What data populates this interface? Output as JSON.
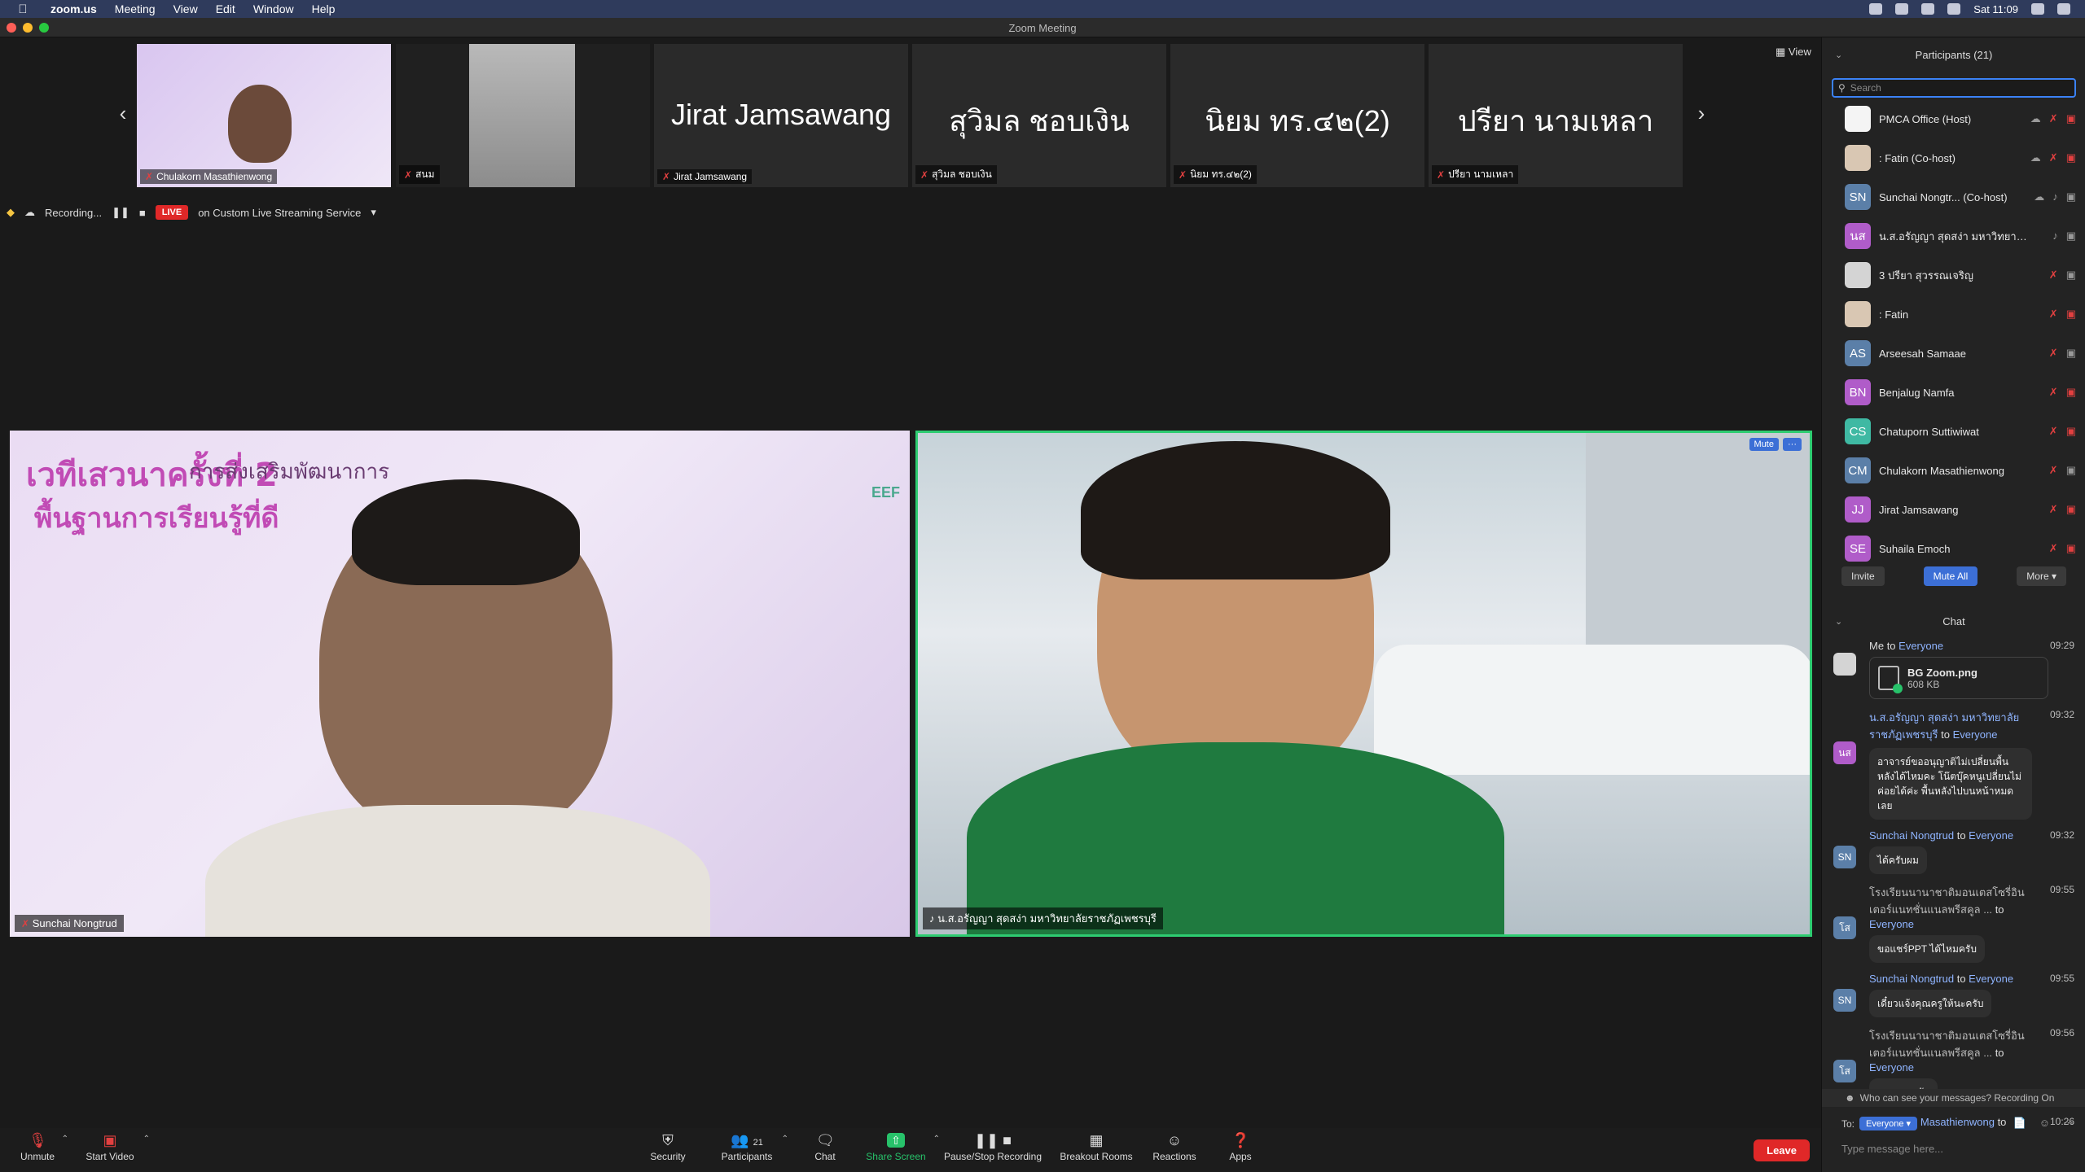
{
  "menubar": {
    "app": "zoom.us",
    "menus": [
      "Meeting",
      "View",
      "Edit",
      "Window",
      "Help"
    ],
    "clock": "Sat 11:09"
  },
  "window": {
    "title": "Zoom Meeting",
    "view_label": "View"
  },
  "strip": {
    "thumbs": [
      {
        "name": "Chulakorn Masathienwong",
        "big": ""
      },
      {
        "name": "สนม",
        "big": ""
      },
      {
        "name": "Jirat Jamsawang",
        "big": "Jirat Jamsawang"
      },
      {
        "name": "สุวิมล ชอบเงิน",
        "big": "สุวิมล  ชอบเงิน"
      },
      {
        "name": "นิยม ทร.๔๒(2)",
        "big": "นิยม ทร.๔๒(2)"
      },
      {
        "name": "ปรียา นามเหลา",
        "big": "ปรียา นามเหลา"
      }
    ]
  },
  "recording": {
    "label": "Recording...",
    "live": "LIVE",
    "service": "on Custom Live Streaming Service"
  },
  "videos": {
    "left": {
      "name": "Sunchai Nongtrud",
      "slide_title": "เวทีเสวนาครั้งที่ 2",
      "slide_sub": "การส่งเสริมพัฒนาการ",
      "slide_sub2": "พื้นฐานการเรียนรู้ที่ดี",
      "brand": "EEF"
    },
    "right": {
      "name": "น.ส.อรัญญา  สุดสง่า มหาวิทยาลัยราชภัฏเพชรบุรี",
      "mute": "Mute",
      "more": "···"
    }
  },
  "toolbar": {
    "unmute": "Unmute",
    "start_video": "Start Video",
    "security": "Security",
    "participants": "Participants",
    "participants_count": "21",
    "chat": "Chat",
    "share_screen": "Share Screen",
    "pause_recording": "Pause/Stop Recording",
    "breakout": "Breakout Rooms",
    "reactions": "Reactions",
    "apps": "Apps",
    "leave": "Leave"
  },
  "participants_panel": {
    "title": "Participants (21)",
    "search_placeholder": "Search",
    "items": [
      {
        "name": "PMCA Office (Host)",
        "initials": "",
        "color": "#f4f4f4"
      },
      {
        "name": ": Fatin (Co-host)",
        "initials": "",
        "color": "#d9c7b3"
      },
      {
        "name": "Sunchai Nongtr... (Co-host)",
        "initials": "SN",
        "color": "#5b7fa8"
      },
      {
        "name": "น.ส.อรัญญา สุดสง่า มหาวิทยาลั...",
        "initials": "นส",
        "color": "#b05cc9"
      },
      {
        "name": "3 ปรียา สุวรรณเจริญ",
        "initials": "",
        "color": "#d4d4d4"
      },
      {
        "name": ": Fatin",
        "initials": "",
        "color": "#d9c7b3"
      },
      {
        "name": "Arseesah Samaae",
        "initials": "AS",
        "color": "#5b7fa8"
      },
      {
        "name": "Benjalug Namfa",
        "initials": "BN",
        "color": "#b05cc9"
      },
      {
        "name": "Chatuporn Suttiwiwat",
        "initials": "CS",
        "color": "#3fb9a3"
      },
      {
        "name": "Chulakorn Masathienwong",
        "initials": "CM",
        "color": "#5b7fa8"
      },
      {
        "name": "Jirat Jamsawang",
        "initials": "JJ",
        "color": "#b05cc9"
      },
      {
        "name": "Suhaila Emoch",
        "initials": "SE",
        "color": "#b05cc9"
      }
    ],
    "invite": "Invite",
    "mute_all": "Mute All",
    "more": "More"
  },
  "chat_panel": {
    "title": "Chat",
    "messages": [
      {
        "from": "Me",
        "to": "Everyone",
        "time": "09:29",
        "file": "BG Zoom.png",
        "size": "608 KB"
      },
      {
        "from": "น.ส.อรัญญา  สุดสง่า มหาวิทยาลัยราชภัฏเพชรบุรี",
        "to": "Everyone",
        "time": "09:32",
        "initials": "นส",
        "color": "#b05cc9",
        "text": "อาจารย์ขออนุญาติไม่เปลี่ยนพื้นหลังได้ไหมคะ โน๊ตบุ๊คหนูเปลี่ยนไม่ค่อยได้ค่ะ พื้นหลังไปบนหน้าหมดเลย"
      },
      {
        "from": "Sunchai Nongtrud",
        "to": "Everyone",
        "time": "09:32",
        "initials": "SN",
        "color": "#5b7fa8",
        "text": "ได้ครับผม"
      },
      {
        "from": "โรงเรียนนานาชาติมอนเตสโซรี่อินเตอร์แนทชั่นแนลพรีสคูล ...",
        "to": "Everyone",
        "time": "09:55",
        "initials": "โส",
        "color": "#5b7fa8",
        "text": "ขอแชร์PPT ได้ไหมครับ"
      },
      {
        "from": "Sunchai Nongtrud",
        "to": "Everyone",
        "time": "09:55",
        "initials": "SN",
        "color": "#5b7fa8",
        "text": "เดี๋ยวแจ้งคุณครูให้นะครับ"
      },
      {
        "from": "โรงเรียนนานาชาติมอนเตสโซรี่อินเตอร์แนทชั่นแนลพรีสคูล ...",
        "to": "Everyone",
        "time": "09:56",
        "initials": "โส",
        "color": "#5b7fa8",
        "text": "ขอบคุณครับ"
      },
      {
        "from": "Chulakorn Masathienwong",
        "to": "",
        "time": "10:26",
        "initials": "",
        "color": "#232323",
        "text": ""
      }
    ],
    "who_can_see": "Who can see your messages? Recording On",
    "to_label": "To:",
    "to_value": "Everyone",
    "input_placeholder": "Type message here..."
  }
}
